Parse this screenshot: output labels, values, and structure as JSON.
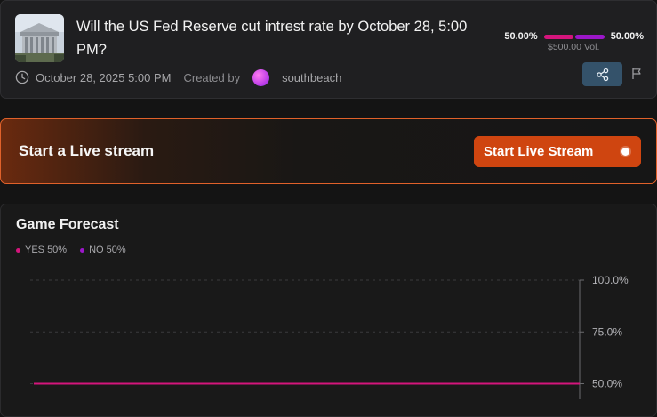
{
  "market": {
    "title": "Will the US Fed Reserve cut intrest rate by October 28, 5:00 PM?",
    "date": "October 28, 2025 5:00 PM",
    "created_by_label": "Created by",
    "creator": "southbeach",
    "yes_pct_label": "50.00%",
    "no_pct_label": "50.00%",
    "yes_share": 0.5,
    "volume": "$500.00 Vol.",
    "thumbnail_icon": "federal-reserve-building-image",
    "icons": {
      "clock": "clock-icon",
      "share": "share-icon",
      "flag": "flag-icon"
    }
  },
  "live": {
    "title": "Start a Live stream",
    "button_label": "Start Live Stream"
  },
  "forecast": {
    "title": "Game Forecast",
    "legend": [
      {
        "label": "YES 50%",
        "color": "#d4157c"
      },
      {
        "label": "NO 50%",
        "color": "#9b17c9"
      }
    ]
  },
  "colors": {
    "accent": "#cf4510",
    "yes": "#d4157c",
    "no": "#9b17c9",
    "share_bg": "#34526a"
  },
  "chart_data": {
    "type": "line",
    "title": "",
    "xlabel": "",
    "ylabel": "",
    "y_ticks": [
      "100.0%",
      "75.0%",
      "50.0%"
    ],
    "ylim": [
      0,
      100
    ],
    "grid": true,
    "series": [
      {
        "name": "YES",
        "values": [
          50,
          50
        ],
        "color": "#d4157c"
      }
    ]
  }
}
